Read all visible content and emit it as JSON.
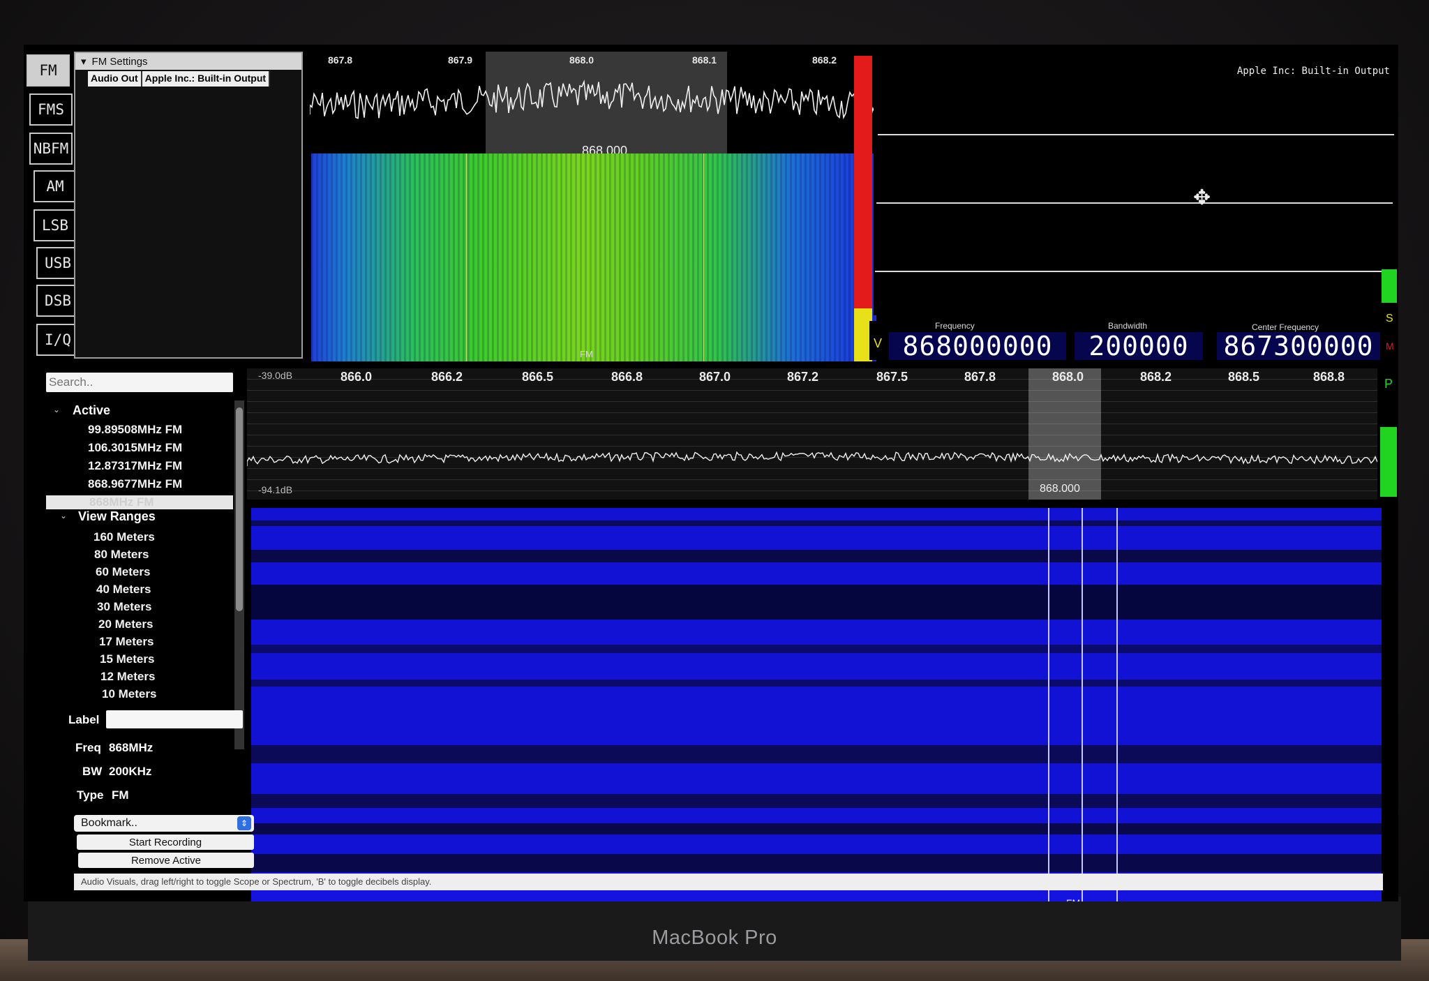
{
  "modes": [
    "FM",
    "FMS",
    "NBFM",
    "AM",
    "LSB",
    "USB",
    "DSB",
    "I/Q"
  ],
  "active_mode": "FM",
  "settings": {
    "title": "FM Settings",
    "audio_out_label": "Audio Out",
    "audio_out_value": "Apple Inc.: Built-in Output"
  },
  "mini_spectrum": {
    "ticks": [
      "867.8",
      "867.9",
      "868.0",
      "868.1",
      "868.2"
    ],
    "center_label": "868.000",
    "mode_marker": "FM"
  },
  "audio_scope": {
    "device_label": "Apple Inc: Built-in Output"
  },
  "tuning": {
    "freq_caption": "Frequency",
    "freq_value": "868000000",
    "bw_caption": "Bandwidth",
    "bw_value": "200000",
    "center_caption": "Center Frequency",
    "center_value": "867300000",
    "v_label": "V",
    "s_label": "S",
    "m_label": "M",
    "p_label": "P"
  },
  "main_spectrum": {
    "db_top": "-39.0dB",
    "db_bottom": "-94.1dB",
    "ticks": [
      "866.0",
      "866.2",
      "866.5",
      "866.8",
      "867.0",
      "867.2",
      "867.5",
      "867.8",
      "868.0",
      "868.2",
      "868.5",
      "868.8"
    ],
    "center_label": "868.000",
    "mode_marker": "FM"
  },
  "bookmarks": {
    "search_placeholder": "Search..",
    "active_header": "Active",
    "active_items": [
      "99.89508MHz FM",
      "106.3015MHz FM",
      "12.87317MHz FM",
      "868.9677MHz FM",
      "868MHz FM"
    ],
    "ranges_header": "View Ranges",
    "ranges": [
      "160 Meters",
      "80 Meters",
      "60 Meters",
      "40 Meters",
      "30 Meters",
      "20 Meters",
      "17 Meters",
      "15 Meters",
      "12 Meters",
      "10 Meters"
    ],
    "label_caption": "Label",
    "freq_caption": "Freq",
    "freq_value": "868MHz",
    "bw_caption": "BW",
    "bw_value": "200KHz",
    "type_caption": "Type",
    "type_value": "FM",
    "bookmark_select": "Bookmark..",
    "start_recording": "Start Recording",
    "remove_active": "Remove Active"
  },
  "status_bar": "Audio Visuals, drag left/right to toggle Scope or Spectrum, 'B' to toggle decibels display.",
  "laptop_brand": "MacBook Pro",
  "colors": {
    "waterfall_top": "#33c83a",
    "waterfall_bottom": "#1a1ad8",
    "digit_bg": "#06064e",
    "meter_red": "#e31b1b",
    "meter_yellow": "#e8e11a",
    "meter_green": "#22d422"
  }
}
